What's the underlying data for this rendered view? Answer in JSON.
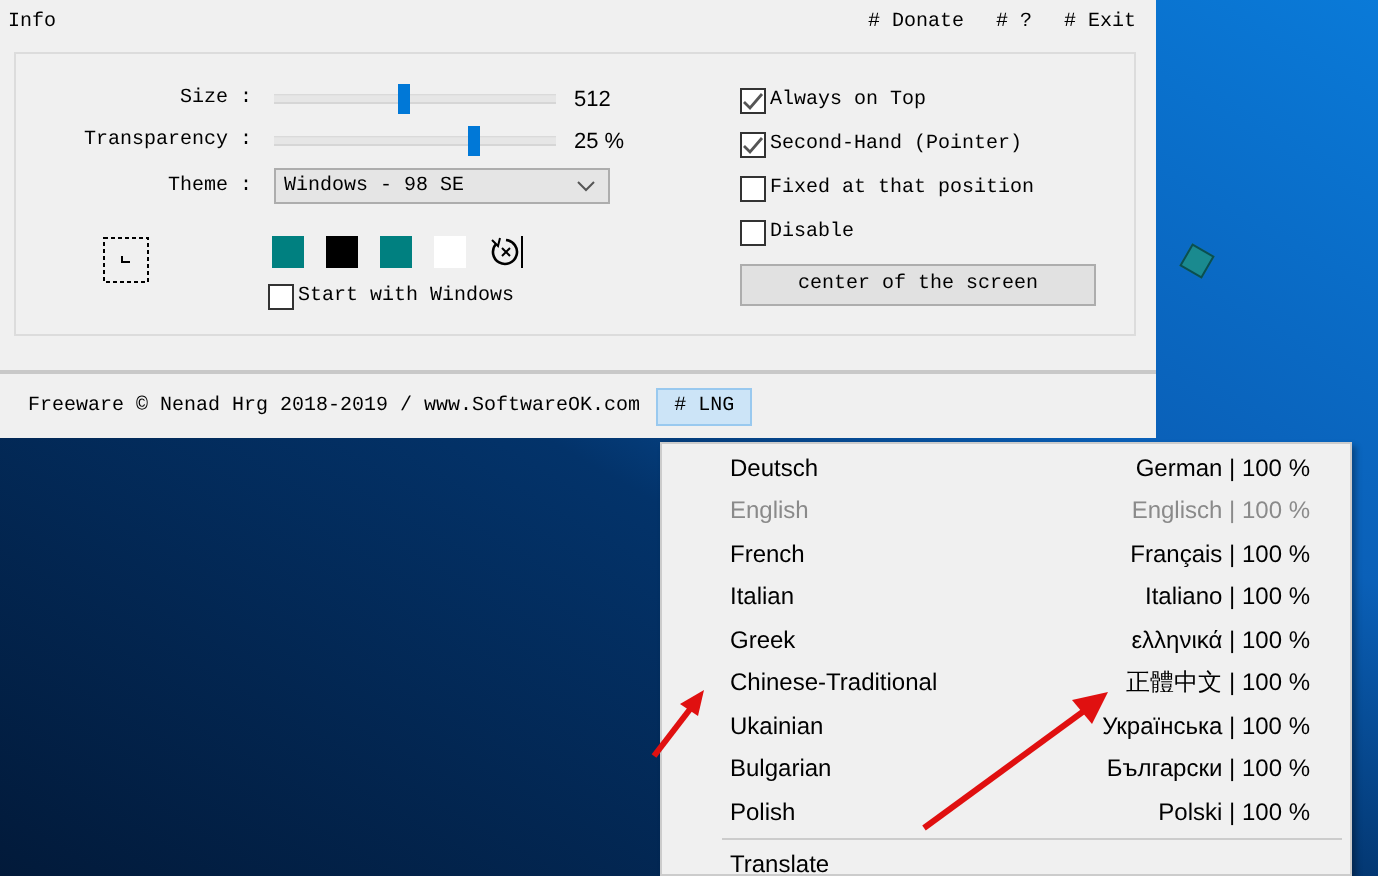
{
  "window": {
    "title": "Info",
    "links": [
      {
        "label": "# Donate"
      },
      {
        "label": "# ?"
      },
      {
        "label": "# Exit"
      }
    ]
  },
  "sliders": [
    {
      "label": "Size :",
      "level": 0.46,
      "reading": "512"
    },
    {
      "label": "Transparency :",
      "level": 0.71,
      "reading": "25 %"
    }
  ],
  "theme": {
    "label": "Theme :",
    "value": "Windows - 98 SE"
  },
  "swatches": [
    {
      "color": "#008080"
    },
    {
      "color": "#000000"
    },
    {
      "color": "#008080"
    },
    {
      "color": "#ffffff"
    }
  ],
  "start_with_windows": {
    "label": "Start with Windows",
    "checked": false
  },
  "options": [
    {
      "label": "Always on Top",
      "checked": true
    },
    {
      "label": "Second-Hand (Pointer)",
      "checked": true
    },
    {
      "label": "Fixed at that position",
      "checked": false
    },
    {
      "label": "Disable",
      "checked": false
    }
  ],
  "center_button": "center of the screen",
  "status_bar": {
    "text": "Freeware © Nenad Hrg 2018-2019 / www.SoftwareOK.com",
    "lng_button": "# LNG"
  },
  "language_menu": {
    "items": [
      {
        "name": "Deutsch",
        "native": "German | 100 %",
        "disabled": false
      },
      {
        "name": "English",
        "native": "Englisch | 100 %",
        "disabled": true
      },
      {
        "name": "French",
        "native": "Français | 100 %",
        "disabled": false
      },
      {
        "name": "Italian",
        "native": "Italiano | 100 %",
        "disabled": false
      },
      {
        "name": "Greek",
        "native": "ελληνικά | 100 %",
        "disabled": false
      },
      {
        "name": "Chinese-Traditional",
        "native": "正體中文 | 100 %",
        "disabled": false
      },
      {
        "name": "Ukainian",
        "native": "Українська | 100 %",
        "disabled": false
      },
      {
        "name": "Bulgarian",
        "native": "Български | 100 %",
        "disabled": false
      },
      {
        "name": "Polish",
        "native": "Polski | 100 %",
        "disabled": false
      }
    ],
    "footer_item": "Translate"
  }
}
